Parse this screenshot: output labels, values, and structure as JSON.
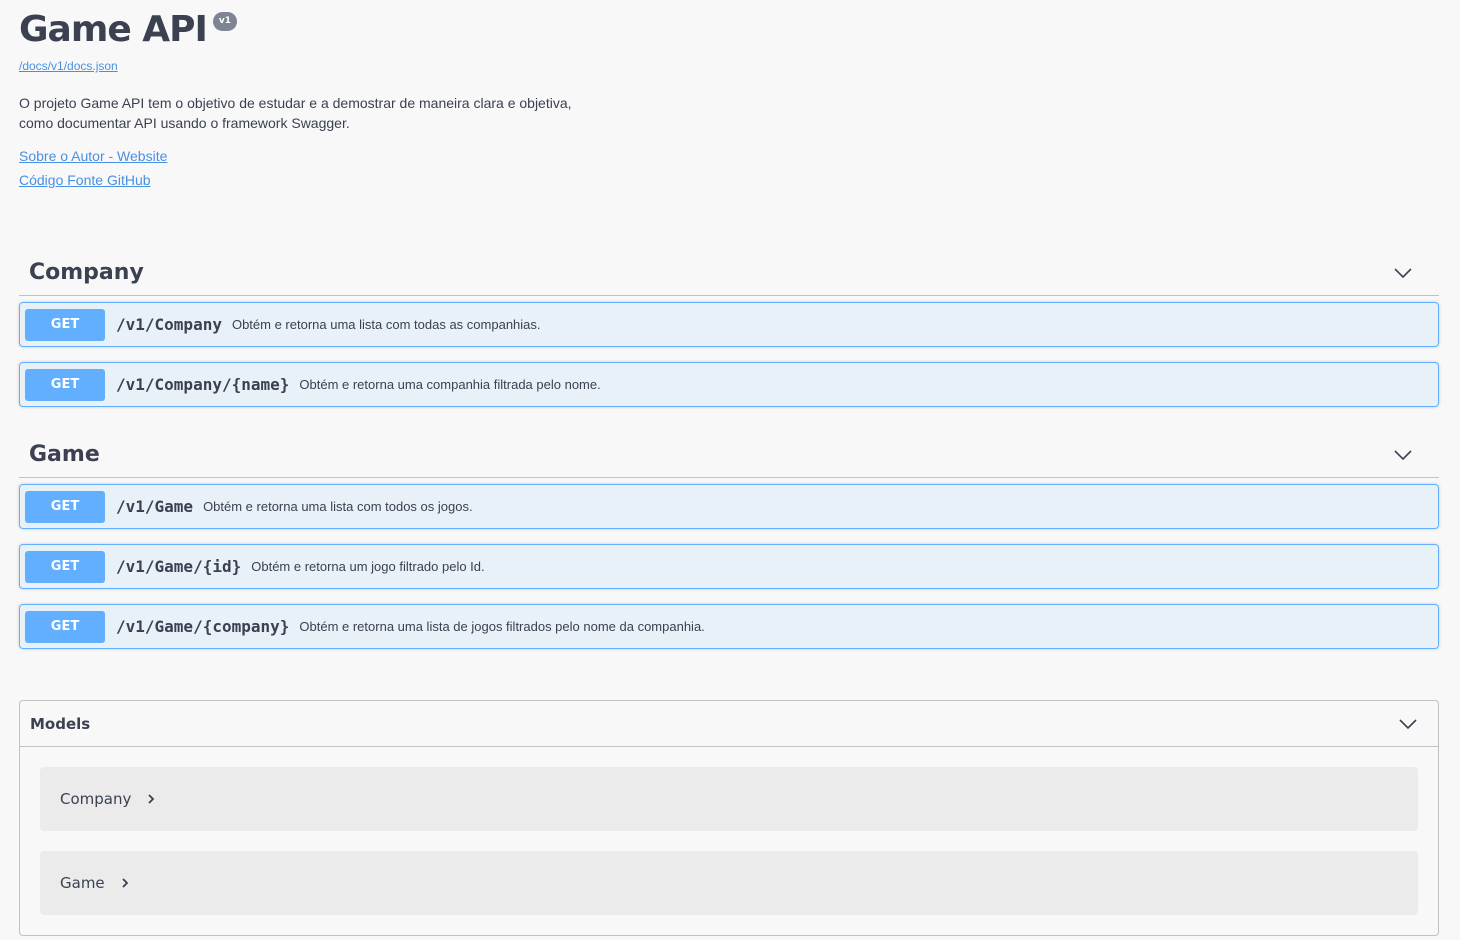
{
  "info": {
    "title": "Game API",
    "version": "v1",
    "spec_url": "/docs/v1/docs.json",
    "description_lines": [
      "O projeto Game API tem o objetivo de estudar e a demostrar de maneira clara e objetiva,",
      "como documentar API usando o framework Swagger."
    ],
    "links": [
      {
        "label": "Sobre o Autor - Website"
      },
      {
        "label": "Código Fonte GitHub"
      }
    ]
  },
  "tags": [
    {
      "name": "Company",
      "operations": [
        {
          "method": "GET",
          "path": "/v1/Company",
          "summary": "Obtém e retorna uma lista com todas as companhias."
        },
        {
          "method": "GET",
          "path": "/v1/Company/{name}",
          "summary": "Obtém e retorna uma companhia filtrada pelo nome."
        }
      ]
    },
    {
      "name": "Game",
      "operations": [
        {
          "method": "GET",
          "path": "/v1/Game",
          "summary": "Obtém e retorna uma lista com todos os jogos."
        },
        {
          "method": "GET",
          "path": "/v1/Game/{id}",
          "summary": "Obtém e retorna um jogo filtrado pelo Id."
        },
        {
          "method": "GET",
          "path": "/v1/Game/{company}",
          "summary": "Obtém e retorna uma lista de jogos filtrados pelo nome da companhia."
        }
      ]
    }
  ],
  "models": {
    "title": "Models",
    "items": [
      {
        "name": "Company"
      },
      {
        "name": "Game"
      }
    ]
  },
  "colors": {
    "get_method": "#61affe",
    "link": "#4990e2",
    "text": "#3b4151",
    "background": "#f8f8f8"
  },
  "icons": {
    "tag_toggle": "chevron-down-icon",
    "model_expand": "chevron-right-icon"
  }
}
